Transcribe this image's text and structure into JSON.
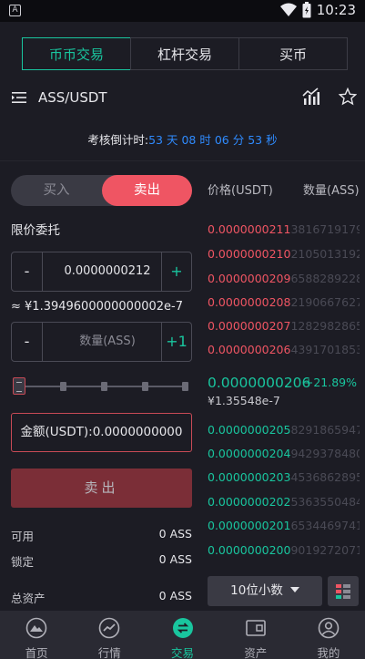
{
  "status_bar": {
    "app_badge": "A",
    "time": "10:23"
  },
  "top_tabs": [
    {
      "label": "币币交易",
      "active": true
    },
    {
      "label": "杠杆交易",
      "active": false
    },
    {
      "label": "买币",
      "active": false
    }
  ],
  "pair": "ASS/USDT",
  "countdown": {
    "label": "考核倒计时:",
    "days": "53",
    "days_unit": "天",
    "hours": "08",
    "hours_unit": "时",
    "minutes": "06",
    "minutes_unit": "分",
    "seconds": "53",
    "seconds_unit": "秒"
  },
  "trade": {
    "buy_label": "买入",
    "sell_label": "卖出",
    "order_type": "限价委托",
    "price_value": "0.0000000212",
    "minus": "-",
    "plus": "+",
    "plus_one": "+1",
    "approx_value": "≈ ¥1.3949600000000002e-7",
    "quantity_placeholder": "数量(ASS)",
    "amount_label": "金额(USDT):0.0000000000",
    "submit_label": "卖出"
  },
  "balances": [
    {
      "label": "可用",
      "value": "0 ASS"
    },
    {
      "label": "锁定",
      "value": "0 ASS"
    },
    {
      "label": "总资产",
      "value": "0 ASS"
    }
  ],
  "orderbook": {
    "price_header": "价格(USDT)",
    "qty_header": "数量(ASS)",
    "asks": [
      {
        "price": "0.0000000211",
        "qty": "38167191793"
      },
      {
        "price": "0.0000000210",
        "qty": "21050131920"
      },
      {
        "price": "0.0000000209",
        "qty": "65882892282"
      },
      {
        "price": "0.0000000208",
        "qty": "21906676278"
      },
      {
        "price": "0.0000000207",
        "qty": "12829828658"
      },
      {
        "price": "0.0000000206",
        "qty": "43917018530"
      }
    ],
    "last_price": "0.0000000206",
    "change": "+21.89%",
    "last_price_cny": "¥1.35548e-7",
    "bids": [
      {
        "price": "0.0000000205",
        "qty": "82918659470"
      },
      {
        "price": "0.0000000204",
        "qty": "94293784805"
      },
      {
        "price": "0.0000000203",
        "qty": "45368628950"
      },
      {
        "price": "0.0000000202",
        "qty": "53635504843"
      },
      {
        "price": "0.0000000201",
        "qty": "65344697411"
      },
      {
        "price": "0.0000000200",
        "qty": "90192720710"
      }
    ],
    "decimals_label": "10位小数"
  },
  "bottom_nav": [
    {
      "label": "首页",
      "icon": "mountain-icon",
      "active": false
    },
    {
      "label": "行情",
      "icon": "trend-chart-icon",
      "active": false
    },
    {
      "label": "交易",
      "icon": "exchange-icon",
      "active": true
    },
    {
      "label": "资产",
      "icon": "wallet-icon",
      "active": false
    },
    {
      "label": "我的",
      "icon": "user-icon",
      "active": false
    }
  ],
  "colors": {
    "accent": "#19c59e",
    "sell": "#ef5563",
    "countdown": "#2f8bff",
    "background": "#1c1c24"
  }
}
